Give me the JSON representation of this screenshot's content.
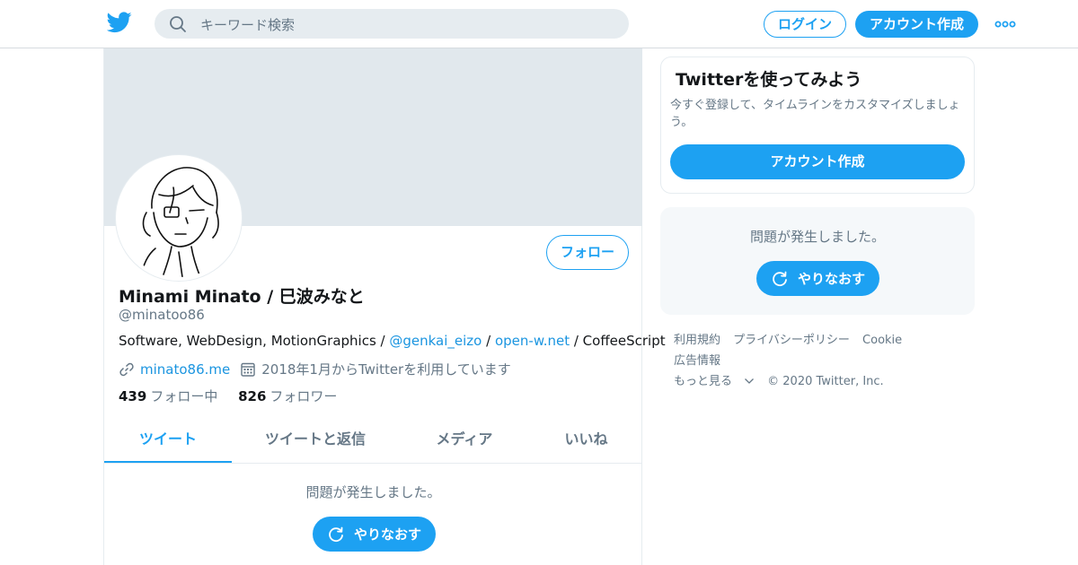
{
  "header": {
    "search_placeholder": "キーワード検索",
    "login_label": "ログイン",
    "signup_label": "アカウント作成",
    "brand_color": "#1da1f2"
  },
  "profile": {
    "display_name": "Minami Minato / 巳波みなと",
    "handle": "@minatoo86",
    "follow_label": "フォロー",
    "bio": {
      "part1": "Software, WebDesign, MotionGraphics / ",
      "link1": "@genkai_eizo",
      "part2": " / ",
      "link2": "open-w.net",
      "part3": " / CoffeeScript"
    },
    "website": "minato86.me",
    "joined": "2018年1月からTwitterを利用しています",
    "following_count": "439",
    "following_label": "フォロー中",
    "followers_count": "826",
    "followers_label": "フォロワー"
  },
  "tabs": [
    {
      "label": "ツイート",
      "active": true
    },
    {
      "label": "ツイートと返信",
      "active": false
    },
    {
      "label": "メディア",
      "active": false
    },
    {
      "label": "いいね",
      "active": false
    }
  ],
  "timeline": {
    "error_message": "問題が発生しました。",
    "retry_label": "やりなおす"
  },
  "sidebar": {
    "signup_card": {
      "title": "Twitterを使ってみよう",
      "description": "今すぐ登録して、タイムラインをカスタマイズしましょう。",
      "button_label": "アカウント作成"
    },
    "error_card": {
      "message": "問題が発生しました。",
      "retry_label": "やりなおす"
    },
    "footer": {
      "links": [
        "利用規約",
        "プライバシーポリシー",
        "Cookie",
        "広告情報"
      ],
      "more_label": "もっと見る",
      "copyright": "© 2020 Twitter, Inc."
    }
  }
}
